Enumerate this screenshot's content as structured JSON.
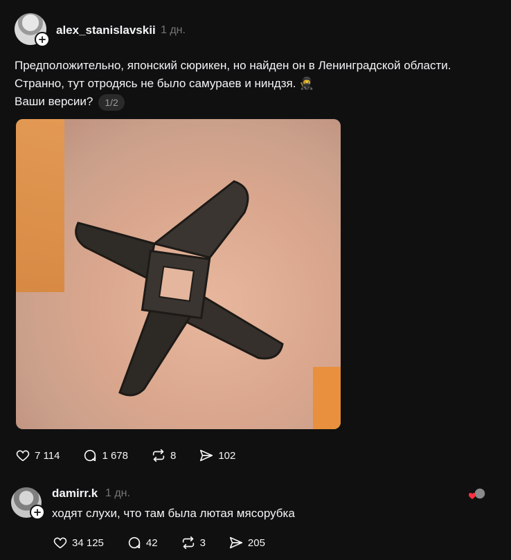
{
  "post": {
    "username": "alex_stanislavskii",
    "timestamp": "1 дн.",
    "text_lines": [
      "Предположительно, японский сюрикен, но найден он в Ленинградской области.",
      "Странно, тут отродясь не было самураев и ниндзя. 🥷",
      "Ваши версии?"
    ],
    "page_indicator": "1/2",
    "actions": {
      "likes": "7 114",
      "comments": "1 678",
      "reposts": "8",
      "shares": "102"
    }
  },
  "reply": {
    "username": "damirr.k",
    "timestamp": "1 дн.",
    "text": "ходят слухи, что там была лютая мясорубка",
    "actions": {
      "likes": "34 125",
      "comments": "42",
      "reposts": "3",
      "shares": "205"
    }
  },
  "icons": {
    "like": "heart-icon",
    "comment": "comment-bubble-icon",
    "repost": "repost-arrows-icon",
    "share": "send-arrow-icon",
    "follow": "plus-icon"
  }
}
